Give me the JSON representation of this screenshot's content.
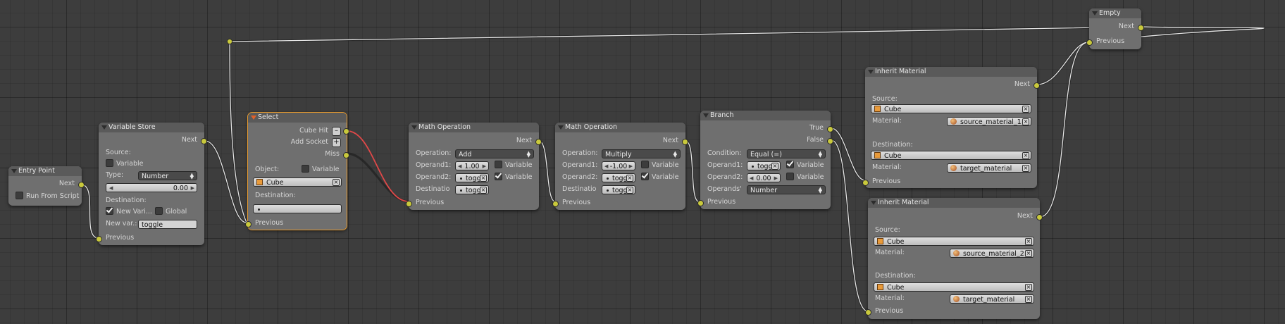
{
  "nodes": {
    "entry_point": {
      "title": "Entry Point",
      "next": "Next",
      "run_from_script": "Run From Script"
    },
    "variable_store": {
      "title": "Variable Store",
      "next": "Next",
      "source": "Source:",
      "variable": "Variable",
      "type_label": "Type:",
      "type_value": "Number",
      "value": "0.00",
      "destination": "Destination:",
      "new_variable": "New Vari...",
      "global": "Global",
      "new_var_label": "New var.:",
      "new_var_value": "toggle",
      "previous": "Previous"
    },
    "select": {
      "title": "Select",
      "cube_hit": "Cube Hit",
      "add_socket": "Add Socket",
      "miss": "Miss",
      "object_label": "Object:",
      "variable": "Variable",
      "object_value": "Cube",
      "destination": "Destination:",
      "previous": "Previous"
    },
    "math_add": {
      "title": "Math Operation",
      "next": "Next",
      "operation_label": "Operation:",
      "operation_value": "Add",
      "operand1_label": "Operand1:",
      "operand1_value": "1.00",
      "variable1": "Variable",
      "operand2_label": "Operand2:",
      "operand2_value": "toggl",
      "variable2": "Variable",
      "destination_label": "Destinatio",
      "destination_value": "toggl",
      "previous": "Previous"
    },
    "math_multiply": {
      "title": "Math Operation",
      "next": "Next",
      "operation_label": "Operation:",
      "operation_value": "Multiply",
      "operand1_label": "Operand1:",
      "operand1_value": "-1.00",
      "variable1": "Variable",
      "operand2_label": "Operand2:",
      "operand2_value": "toggl",
      "variable2": "Variable",
      "destination_label": "Destinatio",
      "destination_value": "toggl",
      "previous": "Previous"
    },
    "branch": {
      "title": "Branch",
      "true": "True",
      "false": "False",
      "condition_label": "Condition:",
      "condition_value": "Equal (=)",
      "operand1_label": "Operand1:",
      "operand1_value": "toggl",
      "variable1": "Variable",
      "operand2_label": "Operand2:",
      "operand2_value": "0.00",
      "variable2": "Variable",
      "operands_label": "Operands'",
      "operands_value": "Number",
      "previous": "Previous"
    },
    "inherit_1": {
      "title": "Inherit Material",
      "next": "Next",
      "source_label": "Source:",
      "source_value": "Cube",
      "material_label": "Material:",
      "material_value": "source_material_1",
      "destination_label": "Destination:",
      "destination_value": "Cube",
      "material2_label": "Material:",
      "material2_value": "target_material",
      "previous": "Previous"
    },
    "inherit_2": {
      "title": "Inherit Material",
      "next": "Next",
      "source_label": "Source:",
      "source_value": "Cube",
      "material_label": "Material:",
      "material_value": "source_material_2",
      "destination_label": "Destination:",
      "destination_value": "Cube",
      "material2_label": "Material:",
      "material2_value": "target_material",
      "previous": "Previous"
    },
    "empty": {
      "title": "Empty",
      "next": "Next",
      "previous": "Previous"
    }
  },
  "colors": {
    "socket": "#c9c93c",
    "selected_link": "#e04848",
    "link": "#e6e6e6",
    "selected_outline": "#e69a2e"
  },
  "icons": {
    "cube": "cube-icon",
    "material": "material-sphere-icon",
    "clear": "x-icon",
    "add": "plus-icon",
    "collapse": "collapse-triangle-icon"
  }
}
